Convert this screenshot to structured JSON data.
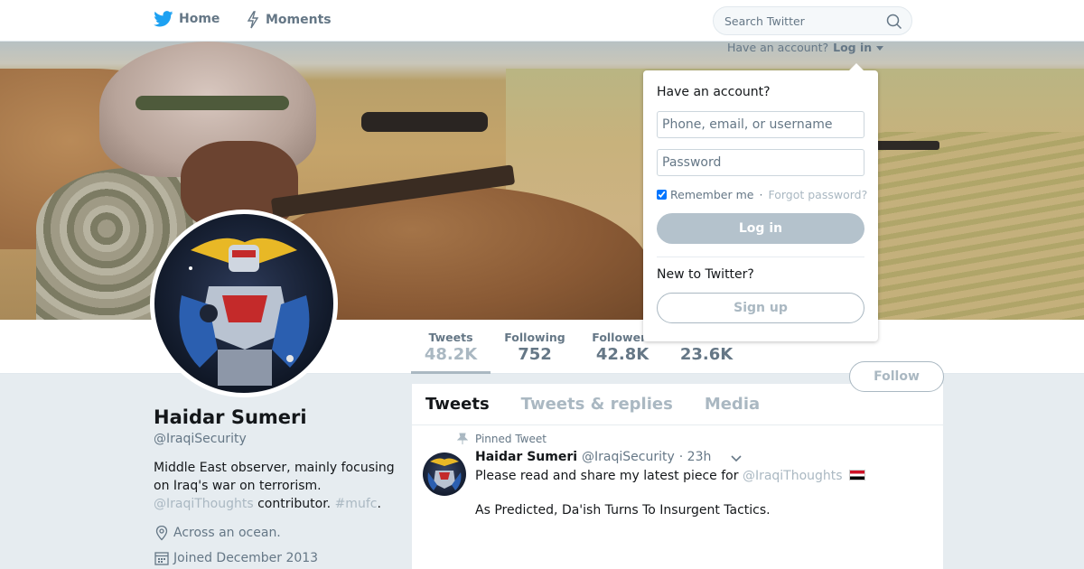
{
  "nav": {
    "home_label": "Home",
    "moments_label": "Moments",
    "search_placeholder": "Search Twitter",
    "have_account": "Have an account?",
    "login_link": "Log in"
  },
  "colors": {
    "twitter_blue": "#1da1f2",
    "muted": "#657786",
    "light_muted": "#aab8c2"
  },
  "icons": {
    "home": "twitter-bird-icon",
    "moments": "lightning-icon",
    "search": "magnifier-icon",
    "location": "location-pin-icon",
    "calendar": "calendar-icon",
    "pin": "pushpin-icon",
    "caret": "chevron-down-icon"
  },
  "stats": {
    "tweets": {
      "label": "Tweets",
      "value": "48.2K"
    },
    "following": {
      "label": "Following",
      "value": "752"
    },
    "followers": {
      "label": "Followers",
      "value": "42.8K"
    },
    "likes": {
      "value": "23.6K"
    }
  },
  "follow_label": "Follow",
  "profile": {
    "name": "Haidar Sumeri",
    "handle": "@IraqiSecurity",
    "bio_text": "Middle East observer, mainly focusing on Iraq's war on terrorism.",
    "bio_mention": "@IraqiThoughts",
    "bio_contributor": " contributor.",
    "bio_hashtag": "#mufc",
    "bio_end": ".",
    "location": "Across an ocean.",
    "joined": "Joined December 2013"
  },
  "timeline": {
    "tabs": [
      "Tweets",
      "Tweets & replies",
      "Media"
    ],
    "pinned_label": "Pinned Tweet",
    "tweet": {
      "name": "Haidar Sumeri",
      "handle": "@IraqiSecurity",
      "time": "· 23h",
      "text_before": "Please read and share my latest piece for ",
      "mention": "@IraqiThoughts",
      "text_line2": "As Predicted, Da'ish Turns To Insurgent Tactics."
    }
  },
  "login": {
    "title": "Have an account?",
    "username_placeholder": "Phone, email, or username",
    "password_placeholder": "Password",
    "remember": "Remember me",
    "separator": "·",
    "forgot": "Forgot password?",
    "login_button": "Log in",
    "new_label": "New to Twitter?",
    "signup_button": "Sign up"
  }
}
